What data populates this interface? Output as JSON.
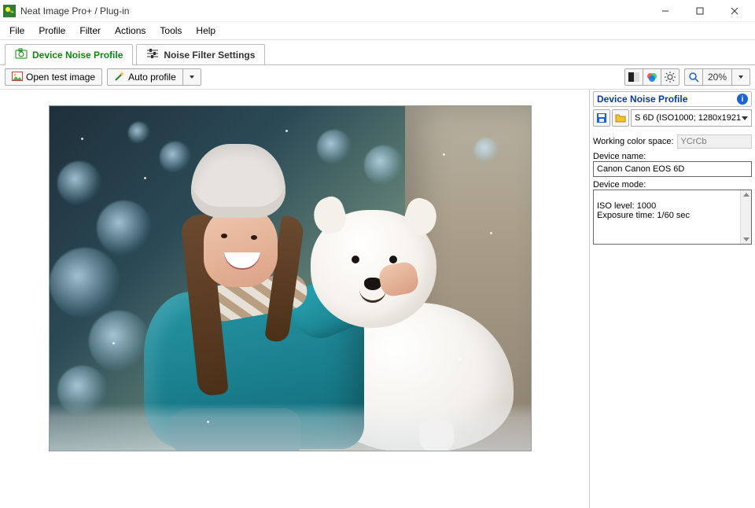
{
  "window": {
    "title": "Neat Image Pro+ / Plug-in"
  },
  "menubar": [
    "File",
    "Profile",
    "Filter",
    "Actions",
    "Tools",
    "Help"
  ],
  "tabs": [
    {
      "label": "Device Noise Profile",
      "active": true
    },
    {
      "label": "Noise Filter Settings",
      "active": false
    }
  ],
  "toolbar": {
    "open_image": "Open test image",
    "auto_profile": "Auto profile",
    "zoom": "20%"
  },
  "side": {
    "header": "Device Noise Profile",
    "profile_selected": "S 6D (ISO1000; 1280x1921",
    "color_space_label": "Working color space:",
    "color_space_value": "YCrCb",
    "device_name_label": "Device name:",
    "device_name_value": "Canon Canon EOS 6D",
    "device_mode_label": "Device mode:",
    "device_mode_value": "ISO level: 1000\nExposure time: 1/60 sec"
  }
}
